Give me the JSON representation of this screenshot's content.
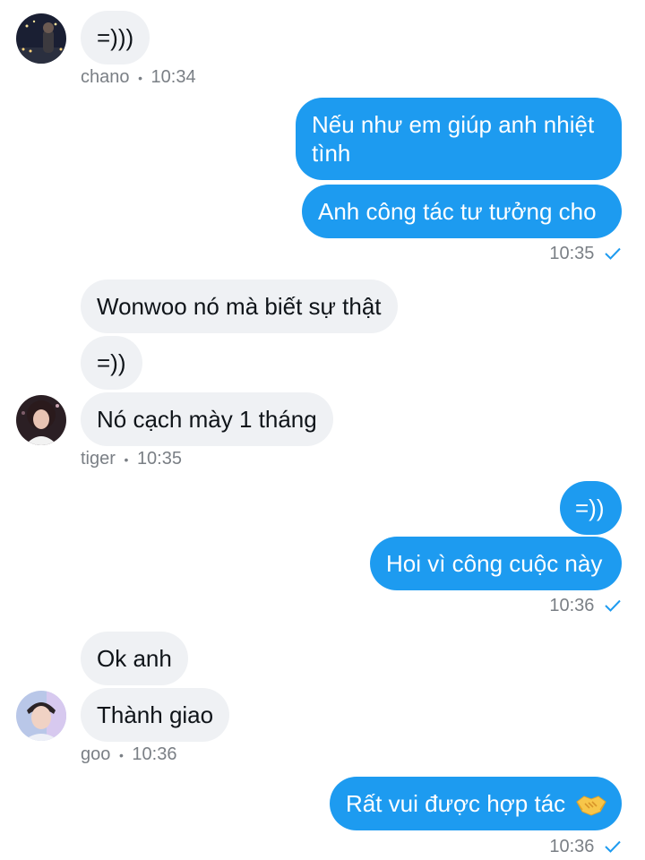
{
  "colors": {
    "accent": "#1d9bf0",
    "incoming_bubble": "#eff1f4",
    "meta_text": "#7a7f85"
  },
  "messages": {
    "chano_1": "=)))",
    "out_1": "Nếu như em giúp anh nhiệt tình",
    "out_2": "Anh công tác tư tưởng cho",
    "tiger_1": "Wonwoo nó mà biết sự thật",
    "tiger_2": "=))",
    "tiger_3": "Nó cạch mày 1 tháng",
    "out_3": "=))",
    "out_4": "Hoi vì công cuộc này",
    "goo_1": "Ok anh",
    "goo_2": "Thành giao",
    "out_5": "Rất vui được hợp tác",
    "out_5_emoji": "handshake-emoji"
  },
  "meta": {
    "chano_name": "chano",
    "chano_time": "10:34",
    "tiger_name": "tiger",
    "tiger_time": "10:35",
    "goo_name": "goo",
    "goo_time": "10:36",
    "sep": "•",
    "out_time_1": "10:35",
    "out_time_2": "10:36",
    "out_time_3": "10:36"
  }
}
